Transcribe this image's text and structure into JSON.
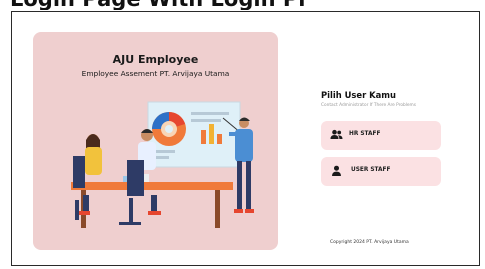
{
  "header": {
    "cropped_text": "Login Page With Login Pi"
  },
  "brand": {
    "title": "AJU Employee",
    "subtitle": "Employee Assement PT. Arvijaya Utama"
  },
  "login": {
    "title": "Pilih User Kamu",
    "hint": "Contact Administrator If There Are Problems",
    "roles": [
      {
        "label": "HR STAFF",
        "icon": "users-icon"
      },
      {
        "label": "USER STAFF",
        "icon": "user-icon"
      }
    ]
  },
  "footer": {
    "copyright": "Copyright 2024 PT. Arvijaya Utama"
  },
  "colors": {
    "panel": "#efcfcf",
    "button": "#fbe1e3",
    "accent": "#f07a3a",
    "board": "#dff0f8"
  }
}
